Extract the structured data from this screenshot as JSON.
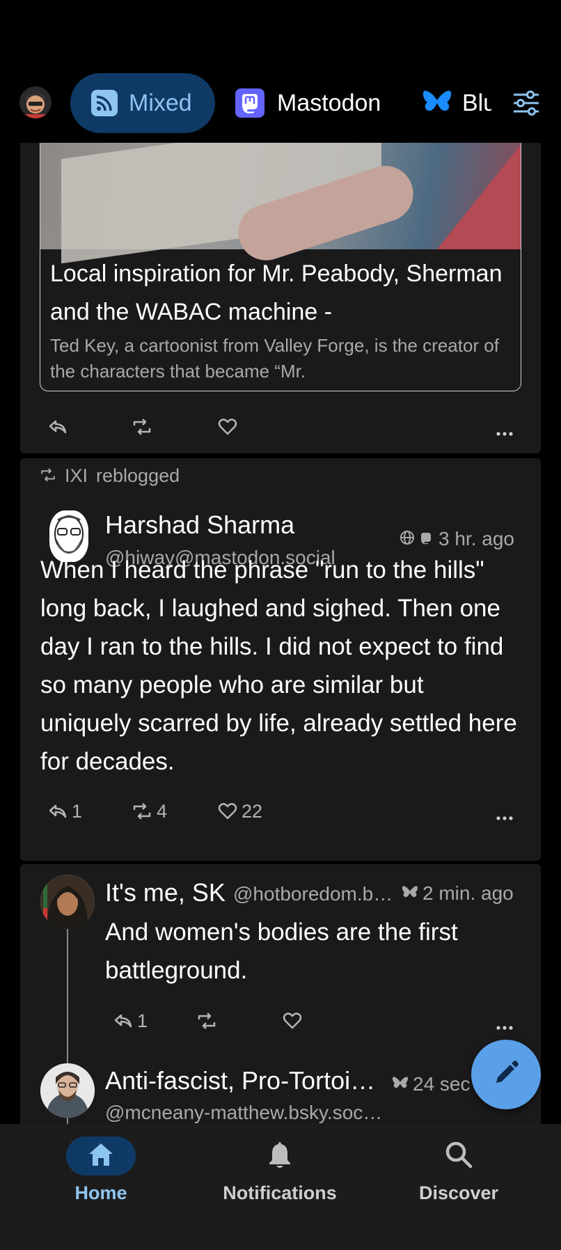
{
  "tabs": [
    {
      "label": "Mixed",
      "icon": "rss-icon",
      "active": true
    },
    {
      "label": "Mastodon",
      "icon": "mastodon-icon",
      "active": false
    },
    {
      "label": "Blu",
      "icon": "butterfly-icon",
      "active": false
    }
  ],
  "post1": {
    "link_title": "Local inspiration for Mr. Peabody, Sherman and the WABAC machine -",
    "link_description": "Ted Key, a cartoonist from Valley Forge, is the creator of the characters that became “Mr."
  },
  "post2": {
    "reblogged_by": "IXI",
    "reblogged_text": "reblogged",
    "author_name": "Harshad Sharma",
    "author_handle": "@hiway@mastodon.social",
    "time": "3 hr. ago",
    "text": "When I heard the phrase \"run to the hills\" long back, I laughed and sighed. Then one day I ran to the hills. I did not expect to find so many people who are similar but uniquely scarred by life, already settled here for decades.",
    "replies": "1",
    "boosts": "4",
    "likes": "22"
  },
  "post3": {
    "author_name": "It's me, SK",
    "author_handle": "@hotboredom.b…",
    "time": "2 min. ago",
    "text": "And women's bodies are the first battleground.",
    "replies": "1"
  },
  "post4": {
    "author_name": "Anti-fascist, Pro-Tortoi…",
    "author_handle": "@mcneany-matthew.bsky.soc…",
    "time": "24 sec"
  },
  "nav": {
    "home": "Home",
    "notifications": "Notifications",
    "discover": "Discover"
  },
  "colors": {
    "accent": "#8ec5f0",
    "accent_bg": "#0f3a66",
    "fab": "#5aa0e8",
    "mastodon": "#6364ff",
    "bluesky": "#1a8cff"
  }
}
